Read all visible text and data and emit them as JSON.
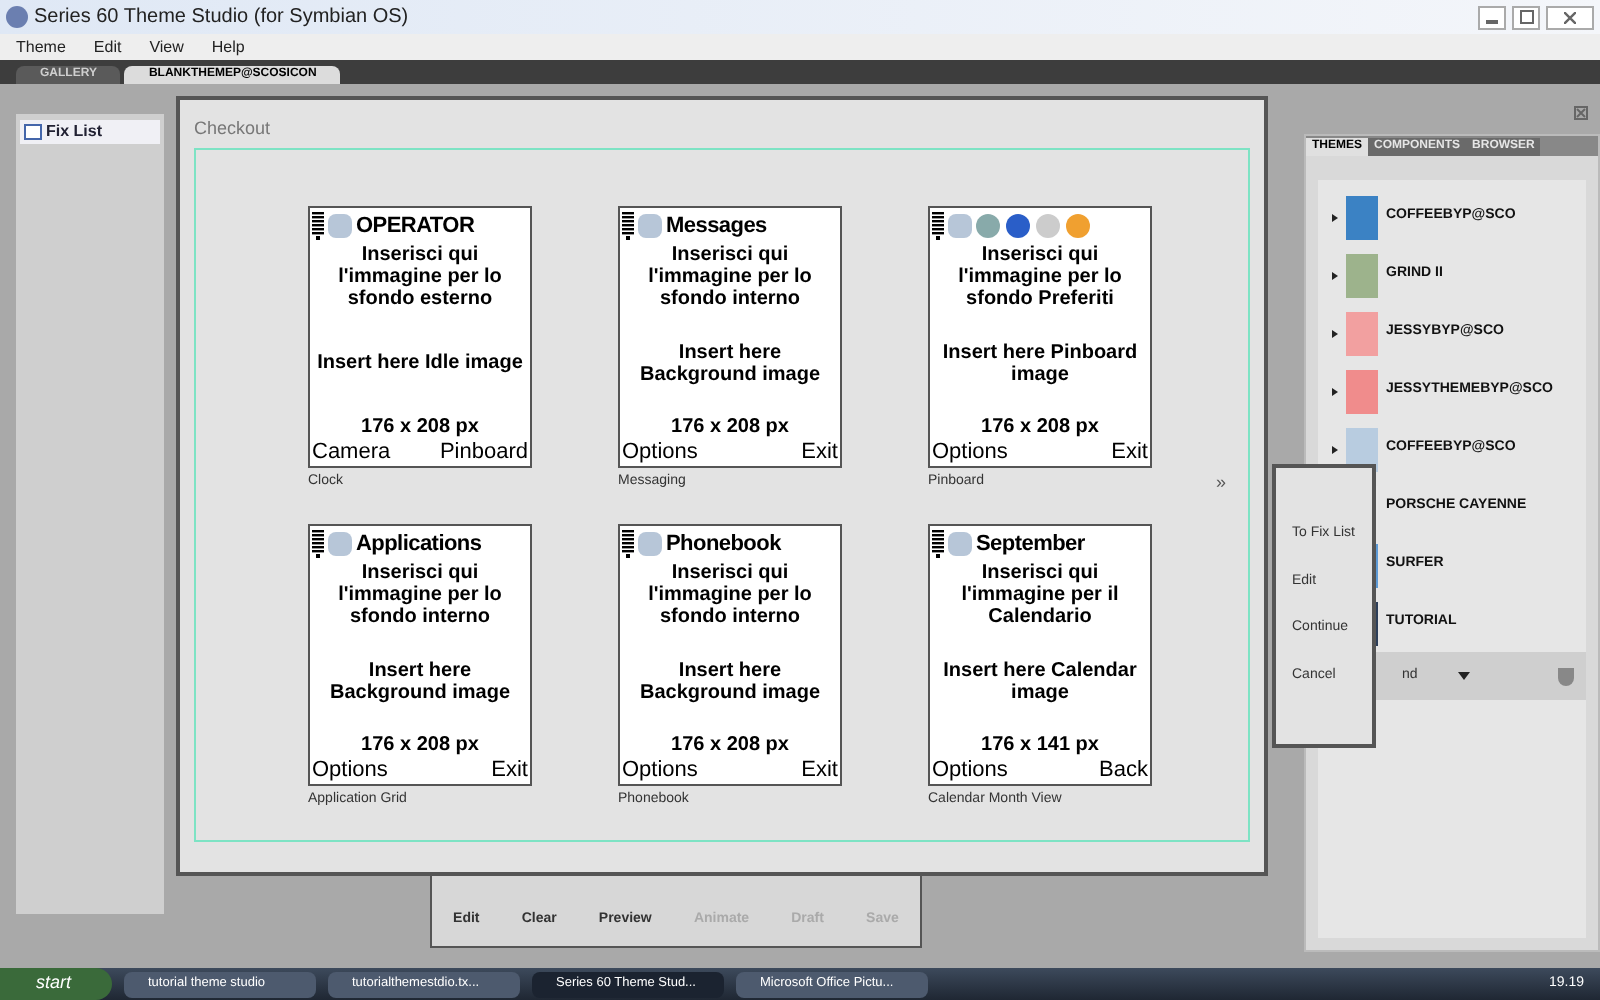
{
  "window": {
    "title": "Series 60 Theme Studio (for Symbian OS)"
  },
  "menu": [
    "Theme",
    "Edit",
    "View",
    "Help"
  ],
  "tabs": [
    {
      "label": "GALLERY",
      "selected": false
    },
    {
      "label": "BLANKTHEMEP@SCOSICON",
      "selected": true
    }
  ],
  "left_panel": {
    "tab": "Fix List"
  },
  "dialog": {
    "title": "Checkout",
    "more": "»",
    "screens": [
      {
        "title": "OPERATOR",
        "hint": "Inserisci qui l'immagine per lo sfondo esterno",
        "label": "Insert here Idle image",
        "size": "176 x 208 px",
        "left_key": "Camera",
        "right_key": "Pinboard",
        "caption": "Clock"
      },
      {
        "title": "Messages",
        "hint": "Inserisci qui l'immagine per lo sfondo interno",
        "label": "Insert here Background image",
        "size": "176 x 208 px",
        "left_key": "Options",
        "right_key": "Exit",
        "caption": "Messaging"
      },
      {
        "hint": "Inserisci qui l'immagine per lo sfondo Preferiti",
        "label": "Insert here Pinboard image",
        "size": "176 x 208 px",
        "left_key": "Options",
        "right_key": "Exit",
        "caption": "Pinboard"
      },
      {
        "title": "Applications",
        "hint": "Inserisci qui l'immagine per lo sfondo interno",
        "label": "Insert here Background image",
        "size": "176 x 208 px",
        "left_key": "Options",
        "right_key": "Exit",
        "caption": "Application Grid"
      },
      {
        "title": "Phonebook",
        "hint": "Inserisci qui l'immagine per lo sfondo interno",
        "label": "Insert here Background image",
        "size": "176 x 208 px",
        "left_key": "Options",
        "right_key": "Exit",
        "caption": "Phonebook"
      },
      {
        "title": "September",
        "hint": "Inserisci qui l'immagine per il Calendario",
        "label": "Insert here Calendar image",
        "size": "176 x 141 px",
        "left_key": "Options",
        "right_key": "Back",
        "caption": "Calendar Month View"
      }
    ]
  },
  "context_menu": [
    "To Fix List",
    "Edit",
    "Continue",
    "Cancel"
  ],
  "toolbar": [
    {
      "label": "Edit",
      "disabled": false
    },
    {
      "label": "Clear",
      "disabled": false
    },
    {
      "label": "Preview",
      "disabled": false
    },
    {
      "label": "Animate",
      "disabled": true
    },
    {
      "label": "Draft",
      "disabled": true
    },
    {
      "label": "Save",
      "disabled": true
    }
  ],
  "right_panel": {
    "tabs": [
      {
        "label": "THEMES",
        "selected": true
      },
      {
        "label": "COMPONENTS",
        "selected": false
      },
      {
        "label": "BROWSER",
        "selected": false
      }
    ],
    "themes": [
      "COFFEEBYP@SCO",
      "GRIND II",
      "JESSYBYP@SCO",
      "JESSYTHEMEBYP@SCO",
      "COFFEEBYP@SCO",
      "PORSCHE CAYENNE",
      "SURFER",
      "TUTORIAL"
    ],
    "filter": "nd"
  },
  "taskbar": {
    "start": "start",
    "tasks": [
      {
        "label": "tutorial theme studio",
        "selected": false
      },
      {
        "label": "tutorialthemestdio.tx...",
        "selected": false
      },
      {
        "label": "Series 60 Theme Stud...",
        "selected": true
      },
      {
        "label": "Microsoft Office Pictu...",
        "selected": false
      }
    ],
    "clock": "19.19"
  }
}
